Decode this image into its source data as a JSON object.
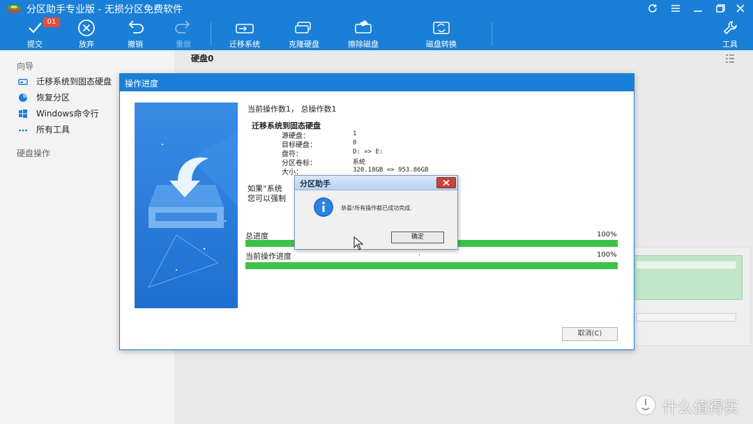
{
  "app": {
    "title": "分区助手专业版 - 无损分区免费软件",
    "accent_color": "#1a7fd6"
  },
  "toolbar": {
    "pending_count": "01",
    "commit": "提交",
    "discard": "放弃",
    "undo": "撤销",
    "redo": "重做",
    "migrate": "迁移系统",
    "clone": "克隆硬盘",
    "wipe": "擦除磁盘",
    "convert": "磁盘转换",
    "tools": "工具"
  },
  "sidebar": {
    "wizard_heading": "向导",
    "items": [
      {
        "label": "迁移系统到固态硬盘",
        "icon": "ssd-icon"
      },
      {
        "label": "恢复分区",
        "icon": "pie-chart-icon"
      },
      {
        "label": "Windows命令行",
        "icon": "windows-icon"
      },
      {
        "label": "所有工具",
        "icon": "more-icon"
      }
    ],
    "disk_ops_heading": "硬盘操作"
  },
  "main": {
    "disk_label": "硬盘0"
  },
  "progress_dialog": {
    "title": "操作进度",
    "op_count": "当前操作数1， 总操作数1",
    "op_name": "迁移系统到固态硬盘",
    "rows": [
      {
        "label": "源硬盘：",
        "value": "1"
      },
      {
        "label": "目标硬盘：",
        "value": "0"
      },
      {
        "label": "盘符：",
        "value": "D: => E:"
      },
      {
        "label": "分区卷标：",
        "value": "系统"
      },
      {
        "label": "大小：",
        "value": "320.18GB => 953.86GB"
      }
    ],
    "note_line1": "如果“系统",
    "note_line2": "您可以强制",
    "total_label": "总进度",
    "total_pct": "100%",
    "total_progress": 1.0,
    "current_label": "当前操作进度",
    "current_pct": "100%",
    "current_progress": 1.0,
    "current_dot": ".",
    "cancel": "取消(C)",
    "progress_color": "#3ec14a"
  },
  "message_box": {
    "title": "分区助手",
    "text": "恭喜!所有操作都已成功完成.",
    "ok": "确定"
  },
  "watermark": {
    "text": "什么值得买"
  }
}
